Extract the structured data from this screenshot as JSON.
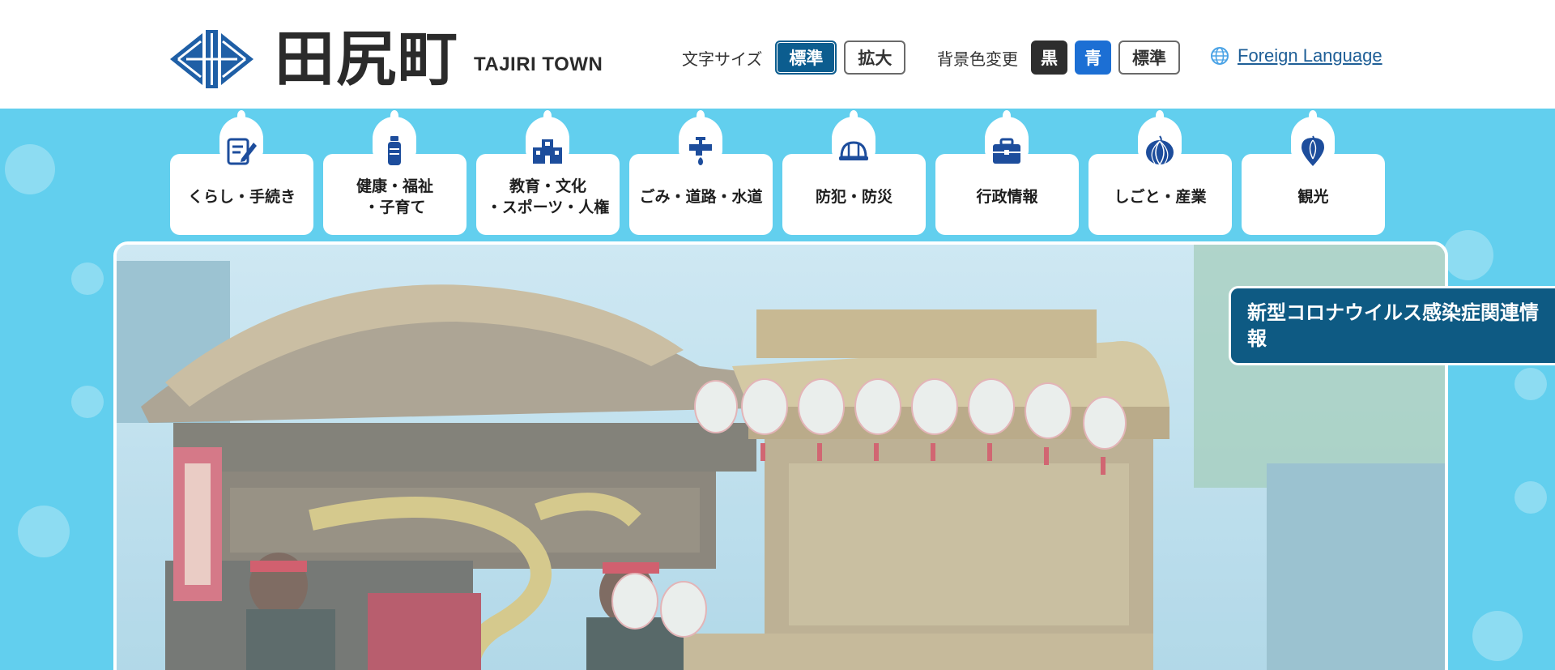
{
  "header": {
    "logo_kanji": "田尻町",
    "logo_roman": "TAJIRI TOWN",
    "text_size": {
      "label": "文字サイズ",
      "standard": "標準",
      "large": "拡大"
    },
    "bg_color": {
      "label": "背景色変更",
      "black": "黒",
      "blue": "青",
      "standard": "標準"
    },
    "language": {
      "icon": "globe-icon",
      "label": "Foreign Language"
    }
  },
  "nav": [
    {
      "label": "くらし・手続き",
      "icon": "form-pen-icon"
    },
    {
      "label": "健康・福祉\n・子育て",
      "icon": "bottle-icon"
    },
    {
      "label": "教育・文化\n・スポーツ・人権",
      "icon": "school-icon"
    },
    {
      "label": "ごみ・道路・水道",
      "icon": "faucet-icon"
    },
    {
      "label": "防犯・防災",
      "icon": "helmet-icon"
    },
    {
      "label": "行政情報",
      "icon": "briefcase-icon"
    },
    {
      "label": "しごと・産業",
      "icon": "onion-icon"
    },
    {
      "label": "観光",
      "icon": "pin-onion-icon"
    }
  ],
  "hero": {
    "banner": "新型コロナウイルス感染症関連情報"
  },
  "colors": {
    "accent_dark_blue": "#0c5d8f",
    "band_sky": "#62cfee",
    "banner": "#0e5a83"
  }
}
